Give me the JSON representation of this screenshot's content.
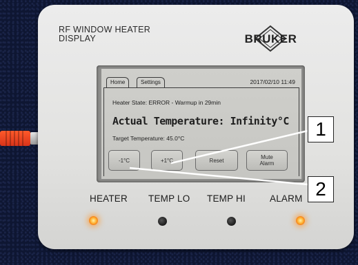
{
  "device": {
    "title_line1": "RF WINDOW HEATER",
    "title_line2": "DISPLAY",
    "brand": "BRUKER"
  },
  "screen": {
    "tabs": [
      {
        "label": "Home",
        "active": true
      },
      {
        "label": "Settings",
        "active": false
      }
    ],
    "datetime": "2017/02/10 11:49",
    "heater_state": "Heater State: ERROR - Warmup in 29min",
    "actual_temperature": "Actual Temperature: Infinity°C",
    "target_temperature": "Target Temperature:  45.0°C",
    "buttons": {
      "minus": "-1°C",
      "plus": "+1°C",
      "reset": "Reset",
      "mute_line1": "Mute",
      "mute_line2": "Alarm"
    }
  },
  "leds": [
    {
      "label": "HEATER",
      "state": "on"
    },
    {
      "label": "TEMP LO",
      "state": "off"
    },
    {
      "label": "TEMP HI",
      "state": "off"
    },
    {
      "label": "ALARM",
      "state": "on"
    }
  ],
  "callouts": [
    {
      "number": "1",
      "target": "plus-button"
    },
    {
      "number": "2",
      "target": "minus-button"
    }
  ],
  "colors": {
    "led_on": "#ffb030",
    "screen_bg": "#cfcfcb",
    "cable": "#e8461f",
    "device_body": "#e6e6e4"
  }
}
